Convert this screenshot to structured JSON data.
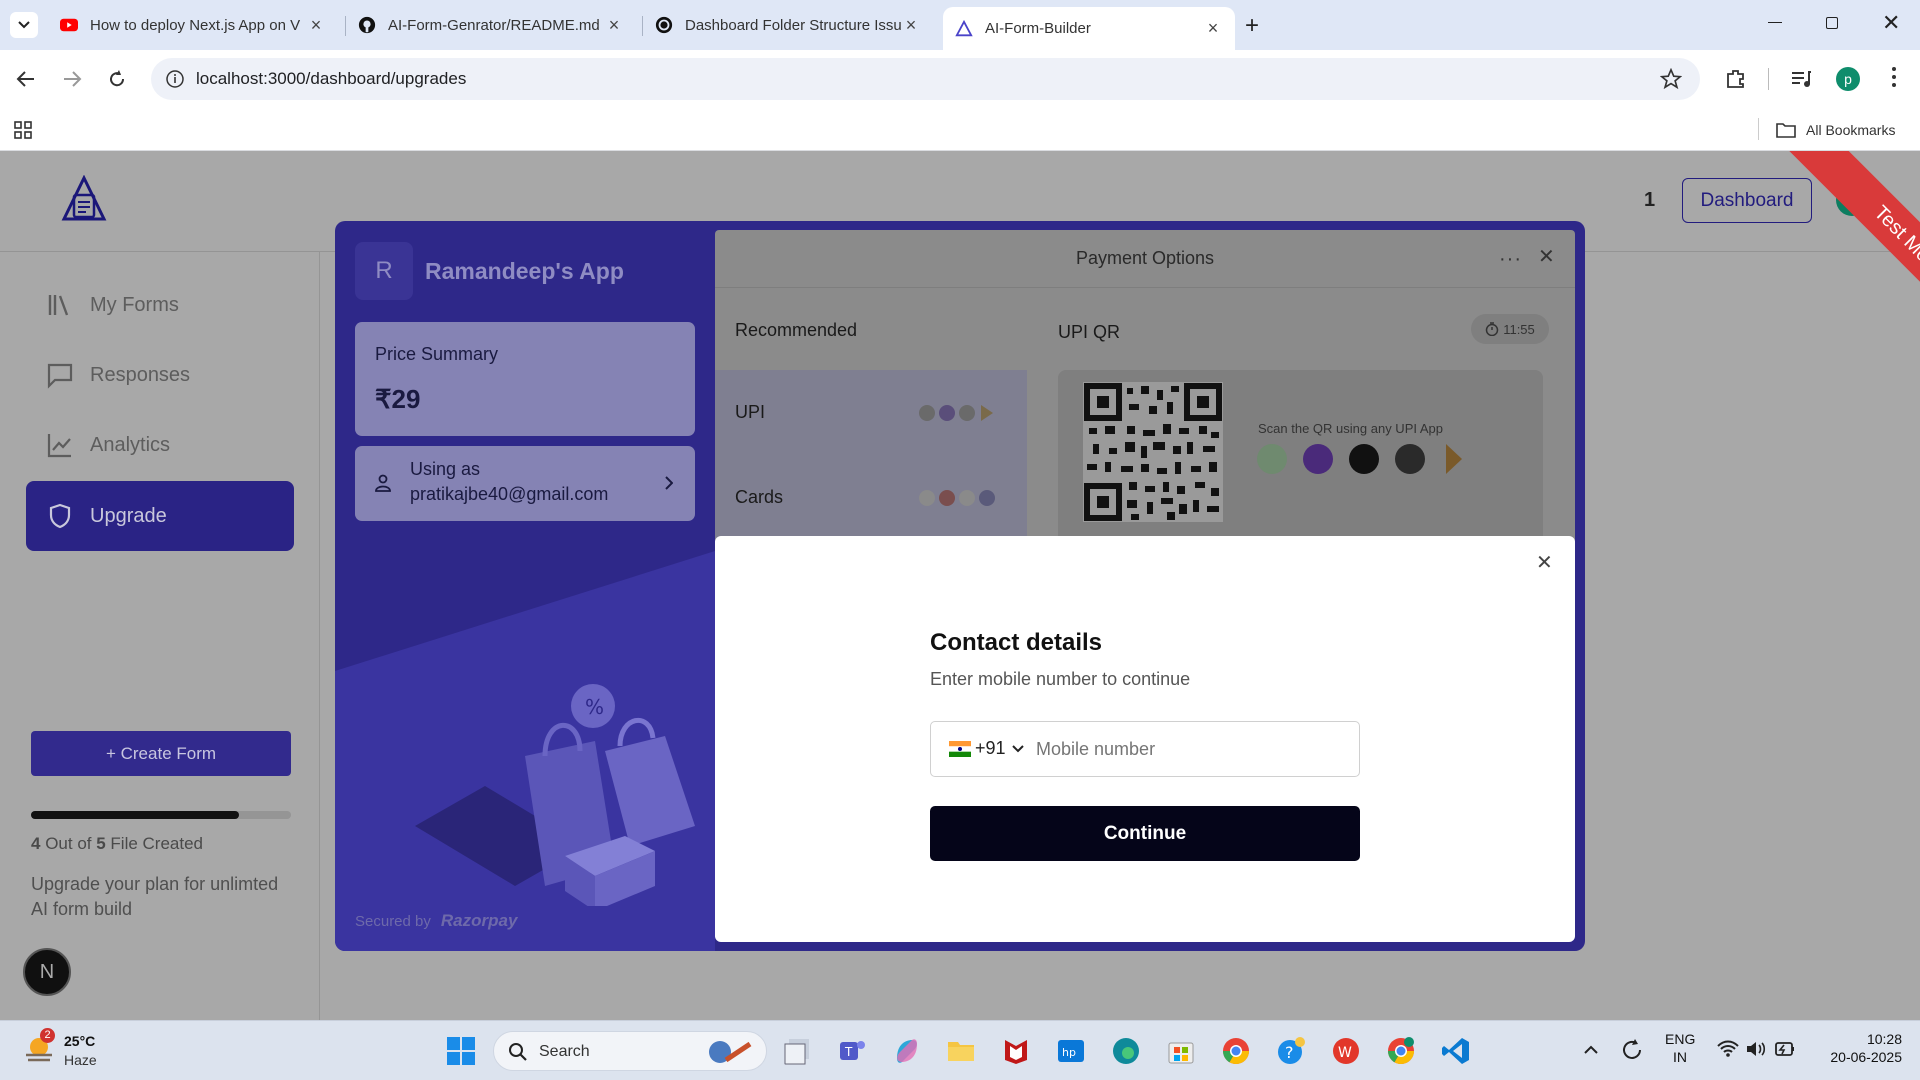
{
  "browser": {
    "tabs": [
      {
        "title": "How to deploy Next.js App on V",
        "icon": "youtube-icon",
        "active": false
      },
      {
        "title": "AI-Form-Genrator/README.md",
        "icon": "github-icon",
        "active": false
      },
      {
        "title": "Dashboard Folder Structure Issu",
        "icon": "chatgpt-icon",
        "active": false
      },
      {
        "title": "AI-Form-Builder",
        "icon": "app-icon",
        "active": true
      }
    ],
    "url": "localhost:3000/dashboard/upgrades",
    "profile_initial": "p",
    "bookmarks_label": "All Bookmarks"
  },
  "app": {
    "header": {
      "count": "1",
      "dashboard_label": "Dashboard",
      "ribbon": "Test Mode"
    },
    "sidebar": {
      "items": [
        {
          "label": "My Forms",
          "icon": "library-icon"
        },
        {
          "label": "Responses",
          "icon": "message-icon"
        },
        {
          "label": "Analytics",
          "icon": "chart-icon"
        },
        {
          "label": "Upgrade",
          "icon": "shield-icon",
          "active": true
        }
      ],
      "create_label": "+ Create Form",
      "progress_fraction": 0.8,
      "usage": {
        "used": "4",
        "mid": " Out of ",
        "total": "5",
        "tail": " File Created"
      },
      "upgrade_note": "Upgrade your plan for unlimted AI form build",
      "avatar_initial": "N"
    }
  },
  "razorpay": {
    "merchant_initial": "R",
    "merchant_name": "Ramandeep's App",
    "price_label": "Price Summary",
    "price": "₹29",
    "using_as_label": "Using as",
    "email": "pratikajbe40@gmail.com",
    "secured_by": "Secured by",
    "brand": "Razorpay",
    "payment_title": "Payment Options",
    "recommended": "Recommended",
    "methods": [
      "UPI",
      "Cards"
    ],
    "upi_qr_label": "UPI QR",
    "timer": "11:55",
    "scan_text": "Scan the QR using any UPI App"
  },
  "contact_modal": {
    "title": "Contact details",
    "subtitle": "Enter mobile number to continue",
    "country_code": "+91",
    "phone_placeholder": "Mobile number",
    "continue_label": "Continue"
  },
  "taskbar": {
    "weather_badge": "2",
    "temperature": "25°C",
    "weather": "Haze",
    "search_label": "Search",
    "lang1": "ENG",
    "lang2": "IN",
    "time": "10:28",
    "date": "20-06-2025"
  },
  "colors": {
    "brand_purple": "#2e2889",
    "continue_button": "#050519",
    "test_ribbon": "#d93a3a"
  }
}
